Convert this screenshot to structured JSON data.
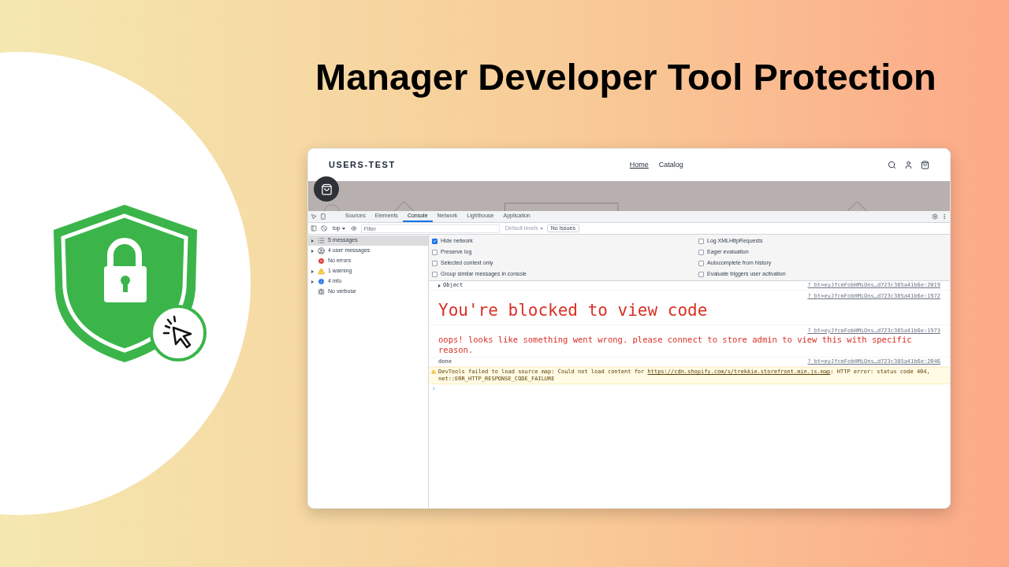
{
  "title": "Manager Developer Tool Protection",
  "store": {
    "logo": "USERS-TEST",
    "nav": [
      {
        "label": "Home",
        "selected": true
      },
      {
        "label": "Catalog",
        "selected": false
      }
    ]
  },
  "devtools": {
    "tabs": [
      {
        "label": "Sources",
        "selected": false
      },
      {
        "label": "Elements",
        "selected": false
      },
      {
        "label": "Console",
        "selected": true
      },
      {
        "label": "Network",
        "selected": false
      },
      {
        "label": "Lighthouse",
        "selected": false
      },
      {
        "label": "Application",
        "selected": false
      }
    ],
    "context": "top",
    "filter_placeholder": "Filter",
    "levels": "Default levels",
    "issues": "No Issues",
    "sidebar": [
      {
        "kind": "all",
        "label": "5 messages",
        "selected": true,
        "expandable": true
      },
      {
        "kind": "user",
        "label": "4 user messages",
        "selected": false,
        "expandable": true
      },
      {
        "kind": "error",
        "label": "No errors",
        "selected": false,
        "expandable": false
      },
      {
        "kind": "warning",
        "label": "1 warning",
        "selected": false,
        "expandable": true
      },
      {
        "kind": "info",
        "label": "4 info",
        "selected": false,
        "expandable": true
      },
      {
        "kind": "verbose",
        "label": "No verbose",
        "selected": false,
        "expandable": false
      }
    ],
    "settings_left": [
      {
        "label": "Hide network",
        "checked": true
      },
      {
        "label": "Preserve log",
        "checked": false
      },
      {
        "label": "Selected context only",
        "checked": false
      },
      {
        "label": "Group similar messages in console",
        "checked": false
      }
    ],
    "settings_right": [
      {
        "label": "Log XMLHttpRequests",
        "checked": false
      },
      {
        "label": "Eager evaluation",
        "checked": false
      },
      {
        "label": "Autocomplete from history",
        "checked": false
      },
      {
        "label": "Evaluate triggers user activation",
        "checked": false
      }
    ],
    "console": [
      {
        "kind": "object",
        "text": "Object",
        "source": "?_bt=eyJfcmFobHMiOns…d723c385a41b6e:2019"
      },
      {
        "kind": "large",
        "text": "You're blocked to view code",
        "source": "?_bt=eyJfcmFobHMiOns…d723c385a41b6e:1972"
      },
      {
        "kind": "medium",
        "text": "oops! looks like something went wrong. please connect to store admin to view this with specific reason.",
        "source": "?_bt=eyJfcmFobHMiOns…d723c385a41b6e:1973"
      },
      {
        "kind": "log",
        "text": "done",
        "source": "?_bt=eyJfcmFobHMiOns…d723c385a41b6e:2046"
      },
      {
        "kind": "warning",
        "text": "DevTools failed to load source map: Could not load content for ",
        "link": "https://cdn.shopify.com/s/trekkie.storefront.min.js.map",
        "after": ": HTTP error: status code 404, net::ERR_HTTP_RESPONSE_CODE_FAILURE"
      }
    ]
  }
}
